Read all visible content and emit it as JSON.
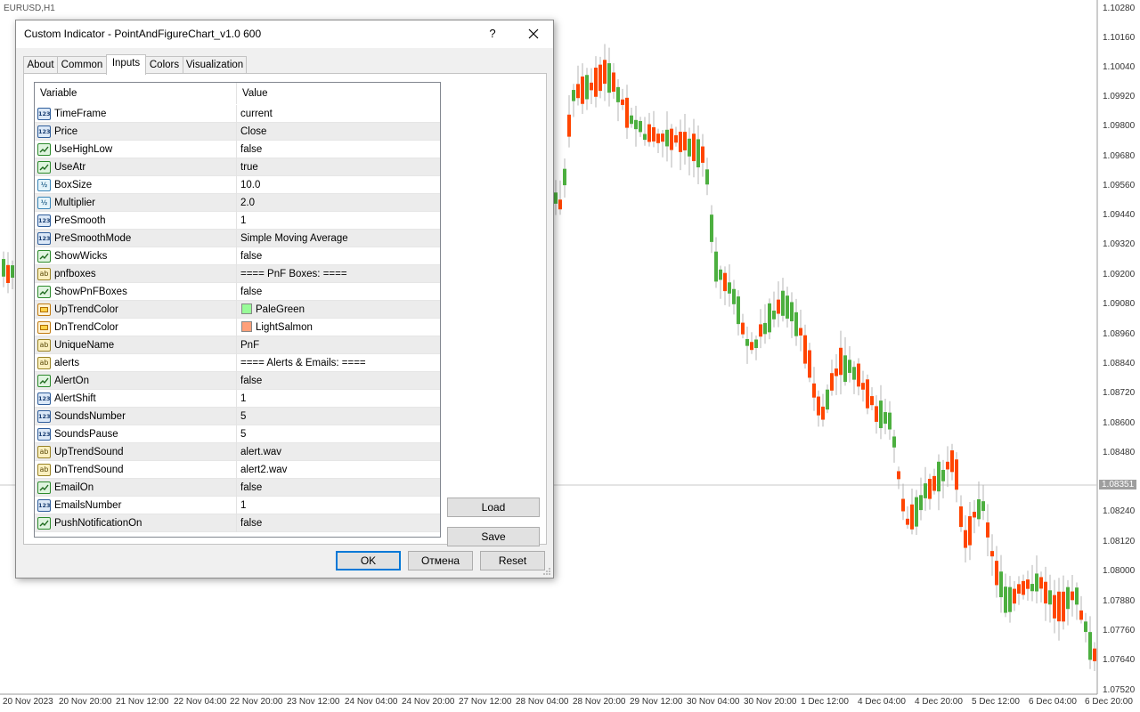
{
  "chart": {
    "symbol": "EURUSD,H1",
    "current_price": "1.08351",
    "up_color": "#4caf3f",
    "down_color": "#ff4500",
    "grid_color": "#e0e0e0",
    "price_labels": [
      "1.10280",
      "1.10160",
      "1.10040",
      "1.09920",
      "1.09800",
      "1.09680",
      "1.09560",
      "1.09440",
      "1.09320",
      "1.09200",
      "1.09080",
      "1.08960",
      "1.08840",
      "1.08720",
      "1.08600",
      "1.08480",
      "1.08240",
      "1.08120",
      "1.08000",
      "1.07880",
      "1.07760",
      "1.07640",
      "1.07520"
    ],
    "time_labels": [
      "20 Nov 2023",
      "20 Nov 20:00",
      "21 Nov 12:00",
      "22 Nov 04:00",
      "22 Nov 20:00",
      "23 Nov 12:00",
      "24 Nov 04:00",
      "24 Nov 20:00",
      "27 Nov 12:00",
      "28 Nov 04:00",
      "28 Nov 20:00",
      "29 Nov 12:00",
      "30 Nov 04:00",
      "30 Nov 20:00",
      "1 Dec 12:00",
      "4 Dec 04:00",
      "4 Dec 20:00",
      "5 Dec 12:00",
      "6 Dec 04:00",
      "6 Dec 20:00"
    ]
  },
  "dialog": {
    "title": "Custom Indicator - PointAndFigureChart_v1.0 600",
    "help_label": "?",
    "tabs": [
      "About",
      "Common",
      "Inputs",
      "Colors",
      "Visualization"
    ],
    "active_tab": "Inputs",
    "columns": {
      "variable": "Variable",
      "value": "Value"
    },
    "params": [
      {
        "icon": "int-icon",
        "badge": "123",
        "name": "TimeFrame",
        "value": "current"
      },
      {
        "icon": "int-icon",
        "badge": "123",
        "name": "Price",
        "value": "Close"
      },
      {
        "icon": "bool-icon",
        "badge": "",
        "name": "UseHighLow",
        "value": "false"
      },
      {
        "icon": "bool-icon",
        "badge": "",
        "name": "UseAtr",
        "value": "true"
      },
      {
        "icon": "double-icon",
        "badge": "½",
        "name": "BoxSize",
        "value": "10.0"
      },
      {
        "icon": "double-icon",
        "badge": "½",
        "name": "Multiplier",
        "value": "2.0"
      },
      {
        "icon": "int-icon",
        "badge": "123",
        "name": "PreSmooth",
        "value": "1"
      },
      {
        "icon": "int-icon",
        "badge": "123",
        "name": "PreSmoothMode",
        "value": "Simple Moving Average"
      },
      {
        "icon": "bool-icon",
        "badge": "",
        "name": "ShowWicks",
        "value": "false"
      },
      {
        "icon": "string-icon",
        "badge": "ab",
        "name": "pnfboxes",
        "value": "==== PnF Boxes: ===="
      },
      {
        "icon": "bool-icon",
        "badge": "",
        "name": "ShowPnFBoxes",
        "value": "false"
      },
      {
        "icon": "color-icon",
        "badge": "",
        "name": "UpTrendColor",
        "value": "PaleGreen",
        "swatch": "#98fb98"
      },
      {
        "icon": "color-icon",
        "badge": "",
        "name": "DnTrendColor",
        "value": "LightSalmon",
        "swatch": "#ffa07a"
      },
      {
        "icon": "string-icon",
        "badge": "ab",
        "name": "UniqueName",
        "value": "PnF"
      },
      {
        "icon": "string-icon",
        "badge": "ab",
        "name": "alerts",
        "value": "==== Alerts & Emails: ===="
      },
      {
        "icon": "bool-icon",
        "badge": "",
        "name": "AlertOn",
        "value": "false"
      },
      {
        "icon": "int-icon",
        "badge": "123",
        "name": "AlertShift",
        "value": "1"
      },
      {
        "icon": "int-icon",
        "badge": "123",
        "name": "SoundsNumber",
        "value": "5"
      },
      {
        "icon": "int-icon",
        "badge": "123",
        "name": "SoundsPause",
        "value": "5"
      },
      {
        "icon": "string-icon",
        "badge": "ab",
        "name": "UpTrendSound",
        "value": "alert.wav"
      },
      {
        "icon": "string-icon",
        "badge": "ab",
        "name": "DnTrendSound",
        "value": "alert2.wav"
      },
      {
        "icon": "bool-icon",
        "badge": "",
        "name": "EmailOn",
        "value": "false"
      },
      {
        "icon": "int-icon",
        "badge": "123",
        "name": "EmailsNumber",
        "value": "1"
      },
      {
        "icon": "bool-icon",
        "badge": "",
        "name": "PushNotificationOn",
        "value": "false"
      }
    ],
    "buttons": {
      "load": "Load",
      "save": "Save",
      "ok": "OK",
      "cancel": "Отмена",
      "reset": "Reset"
    }
  }
}
